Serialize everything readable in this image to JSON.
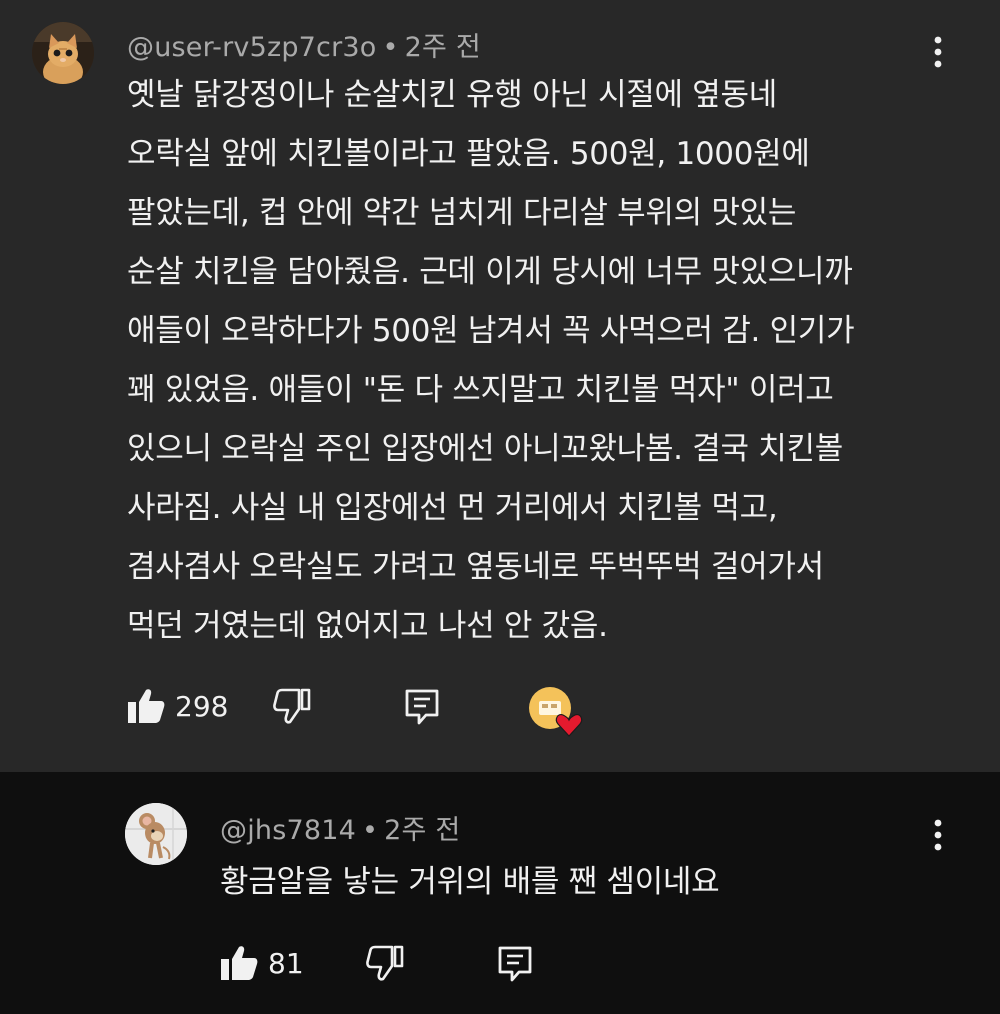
{
  "main_comment": {
    "author": "@user-rv5zp7cr3o",
    "separator": "•",
    "time": "2주 전",
    "text": "옛날 닭강정이나 순살치킨 유행 아닌 시절에 옆동네\n오락실 앞에 치킨볼이라고 팔았음. 500원, 1000원에\n팔았는데, 컵 안에 약간 넘치게 다리살 부위의 맛있는\n순살 치킨을 담아줬음. 근데 이게 당시에 너무 맛있으니까\n애들이 오락하다가 500원 남겨서 꼭 사먹으러 감. 인기가\n꽤 있었음. 애들이 \"돈 다 쓰지말고 치킨볼 먹자\" 이러고\n있으니 오락실 주인 입장에선 아니꼬왔나봄. 결국 치킨볼\n사라짐. 사실 내 입장에선 먼 거리에서 치킨볼 먹고,\n겸사겸사 오락실도 가려고 옆동네로 뚜벅뚜벅 걸어가서\n먹던 거였는데 없어지고 나선 안 갔음.",
    "likes": "298",
    "icons": {
      "avatar": "kitten-avatar",
      "more": "more-vert-icon",
      "like": "thumb-up-icon",
      "dislike": "thumb-down-icon",
      "reply": "reply-icon",
      "creator_heart": "creator-heart-icon"
    }
  },
  "reply_comment": {
    "author": "@jhs7814",
    "separator": "•",
    "time": "2주 전",
    "text": "황금알을 낳는 거위의 배를 짼 셈이네요",
    "likes": "81",
    "icons": {
      "avatar": "cartoon-mouse-avatar",
      "more": "more-vert-icon",
      "like": "thumb-up-icon",
      "dislike": "thumb-down-icon",
      "reply": "reply-icon"
    }
  },
  "colors": {
    "main_bg": "#282828",
    "reply_bg": "#0f0f0f",
    "text": "#f1f1f1",
    "meta": "#aaaaaa",
    "heart": "#e41a2e"
  }
}
